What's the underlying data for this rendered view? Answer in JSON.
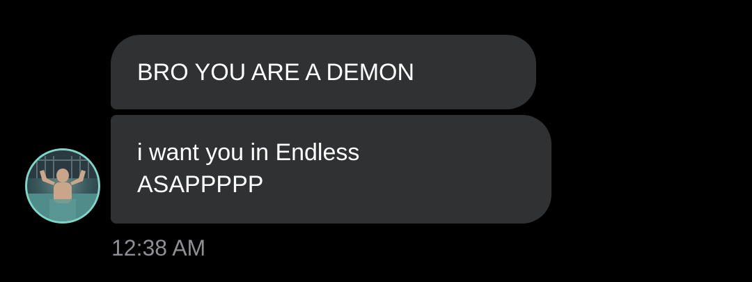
{
  "messages": [
    {
      "lines": [
        "BRO YOU ARE A DEMON"
      ]
    },
    {
      "lines": [
        "i want you in Endless",
        "ASAPPPPP"
      ]
    }
  ],
  "sender": {
    "avatar_icon": "profile-photo-icon",
    "avatar_ring_color": "#7fd6c8"
  },
  "timestamp": "12:38 AM",
  "colors": {
    "background": "#000000",
    "bubble": "#2f3133",
    "text": "#ffffff",
    "timestamp": "#8e8e93"
  }
}
